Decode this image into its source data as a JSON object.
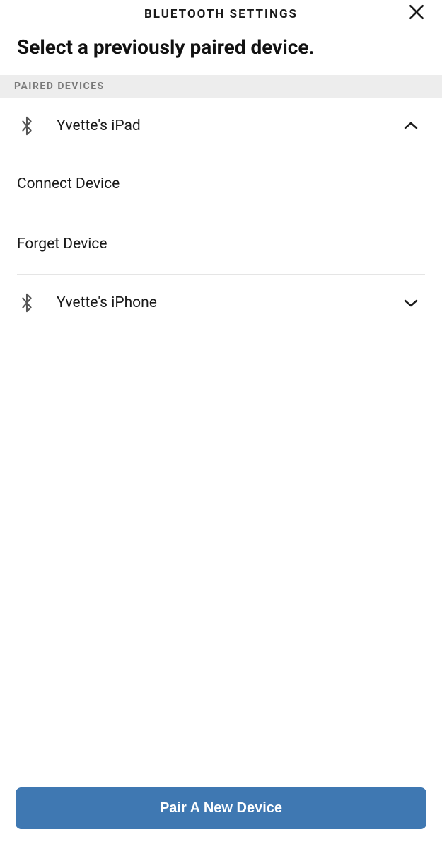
{
  "header": {
    "title": "BLUETOOTH SETTINGS"
  },
  "subtitle": "Select a previously paired device.",
  "section_label": "PAIRED DEVICES",
  "devices": [
    {
      "name": "Yvette's iPad",
      "expanded": true,
      "actions": {
        "connect": "Connect Device",
        "forget": "Forget Device"
      }
    },
    {
      "name": "Yvette's iPhone",
      "expanded": false
    }
  ],
  "footer": {
    "pair_button": "Pair A New Device"
  }
}
